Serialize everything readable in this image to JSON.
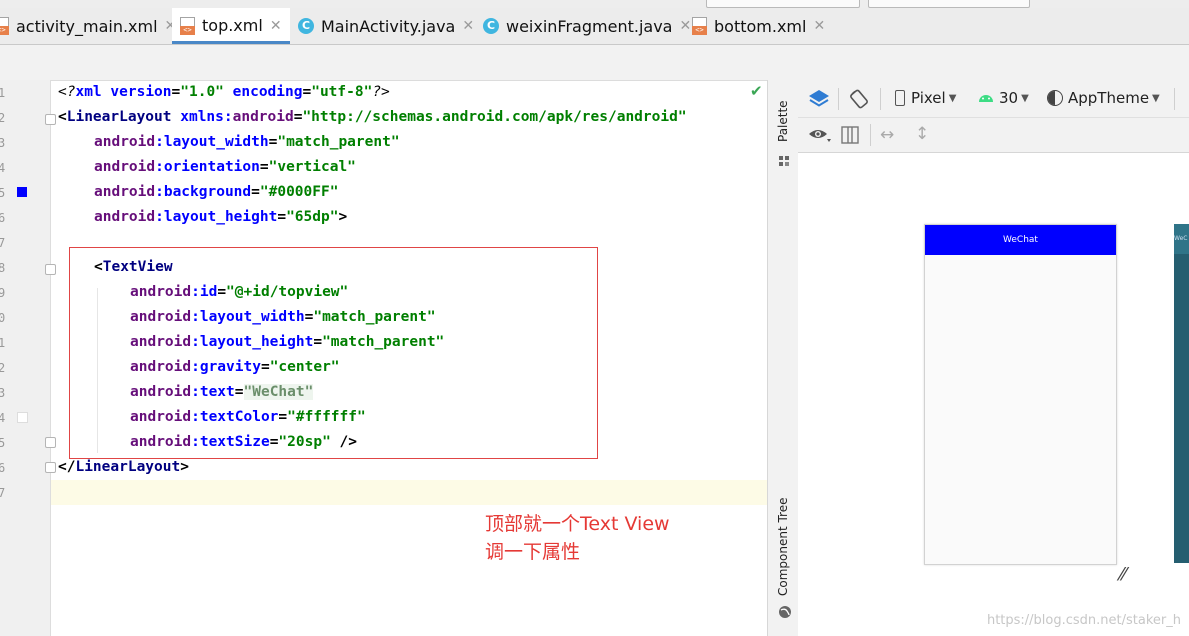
{
  "tabs": [
    {
      "label": "activity_main.xml",
      "icon": "xml-file-icon",
      "active": false
    },
    {
      "label": "top.xml",
      "icon": "xml-file-icon",
      "active": true
    },
    {
      "label": "MainActivity.java",
      "icon": "java-class-icon",
      "active": false
    },
    {
      "label": "weixinFragment.java",
      "icon": "java-class-icon",
      "active": false
    },
    {
      "label": "bottom.xml",
      "icon": "xml-file-icon",
      "active": false
    }
  ],
  "editor": {
    "line_numbers": [
      "1",
      "2",
      "3",
      "4",
      "5",
      "6",
      "7",
      "8",
      "9",
      "0",
      "1",
      "2",
      "3",
      "4",
      "5",
      "6",
      "7"
    ],
    "lines": {
      "l1": {
        "a": "<?",
        "b": "xml",
        "c": " version",
        "d": "=",
        "e": "\"1.0\"",
        "f": " encoding",
        "g": "=",
        "h": "\"utf-8\"",
        "i": "?>"
      },
      "l2": {
        "a": "<",
        "b": "LinearLayout",
        "c": " xmlns:",
        "d": "android",
        "e": "=",
        "f": "\"http://schemas.android.com/apk/res/android\""
      },
      "l3": {
        "a": "android",
        "b": ":layout_width",
        "c": "=",
        "d": "\"match_parent\""
      },
      "l4": {
        "a": "android",
        "b": ":orientation",
        "c": "=",
        "d": "\"vertical\""
      },
      "l5": {
        "a": "android",
        "b": ":background",
        "c": "=",
        "d": "\"#0000FF\""
      },
      "l6": {
        "a": "android",
        "b": ":layout_height",
        "c": "=",
        "d": "\"65dp\"",
        "e": ">"
      },
      "l8": {
        "a": "<",
        "b": "TextView"
      },
      "l9": {
        "a": "android",
        "b": ":id",
        "c": "=",
        "d": "\"@+id/topview\""
      },
      "l10": {
        "a": "android",
        "b": ":layout_width",
        "c": "=",
        "d": "\"match_parent\""
      },
      "l11": {
        "a": "android",
        "b": ":layout_height",
        "c": "=",
        "d": "\"match_parent\""
      },
      "l12": {
        "a": "android",
        "b": ":gravity",
        "c": "=",
        "d": "\"center\""
      },
      "l13": {
        "a": "android",
        "b": ":text",
        "c": "=",
        "d": "\"WeChat\""
      },
      "l14": {
        "a": "android",
        "b": ":textColor",
        "c": "=",
        "d": "\"#ffffff\""
      },
      "l15": {
        "a": "android",
        "b": ":textSize",
        "c": "=",
        "d": "\"20sp\"",
        "e": " />"
      },
      "l16": {
        "a": "</",
        "b": "LinearLayout",
        "c": ">"
      }
    },
    "color_swatch": "#0000FF",
    "white_swatch": "#ffffff"
  },
  "annotation": {
    "line1": "顶部就一个Text View",
    "line2": "调一下属性"
  },
  "side_panel": {
    "palette": "Palette",
    "component_tree": "Component Tree"
  },
  "design_toolbar": {
    "device": "Pixel",
    "api": "30",
    "theme": "AppTheme"
  },
  "preview": {
    "top_bar_text": "WeChat",
    "top_bar_color": "#0000FF",
    "blueprint_text": "WeC"
  },
  "watermark": "https://blog.csdn.net/staker_h"
}
